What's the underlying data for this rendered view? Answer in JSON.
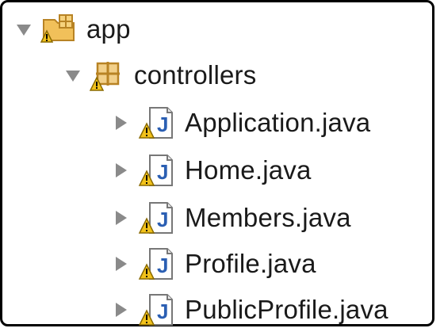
{
  "tree": {
    "project": {
      "label": "app",
      "expanded": true,
      "icon": "package-folder-icon"
    },
    "package": {
      "label": "controllers",
      "expanded": true,
      "icon": "package-icon"
    },
    "files": [
      {
        "label": "Application.java",
        "icon": "java-file-warning-icon"
      },
      {
        "label": "Home.java",
        "icon": "java-file-warning-icon"
      },
      {
        "label": "Members.java",
        "icon": "java-file-warning-icon"
      },
      {
        "label": "Profile.java",
        "icon": "java-file-warning-icon"
      },
      {
        "label": "PublicProfile.java",
        "icon": "java-file-warning-icon"
      }
    ]
  },
  "colors": {
    "text": "#1a1a1a",
    "twisty": "#8a8a8a",
    "package": "#c98a2a",
    "java_file": "#2b5fb3",
    "warning": "#f2c21b"
  }
}
